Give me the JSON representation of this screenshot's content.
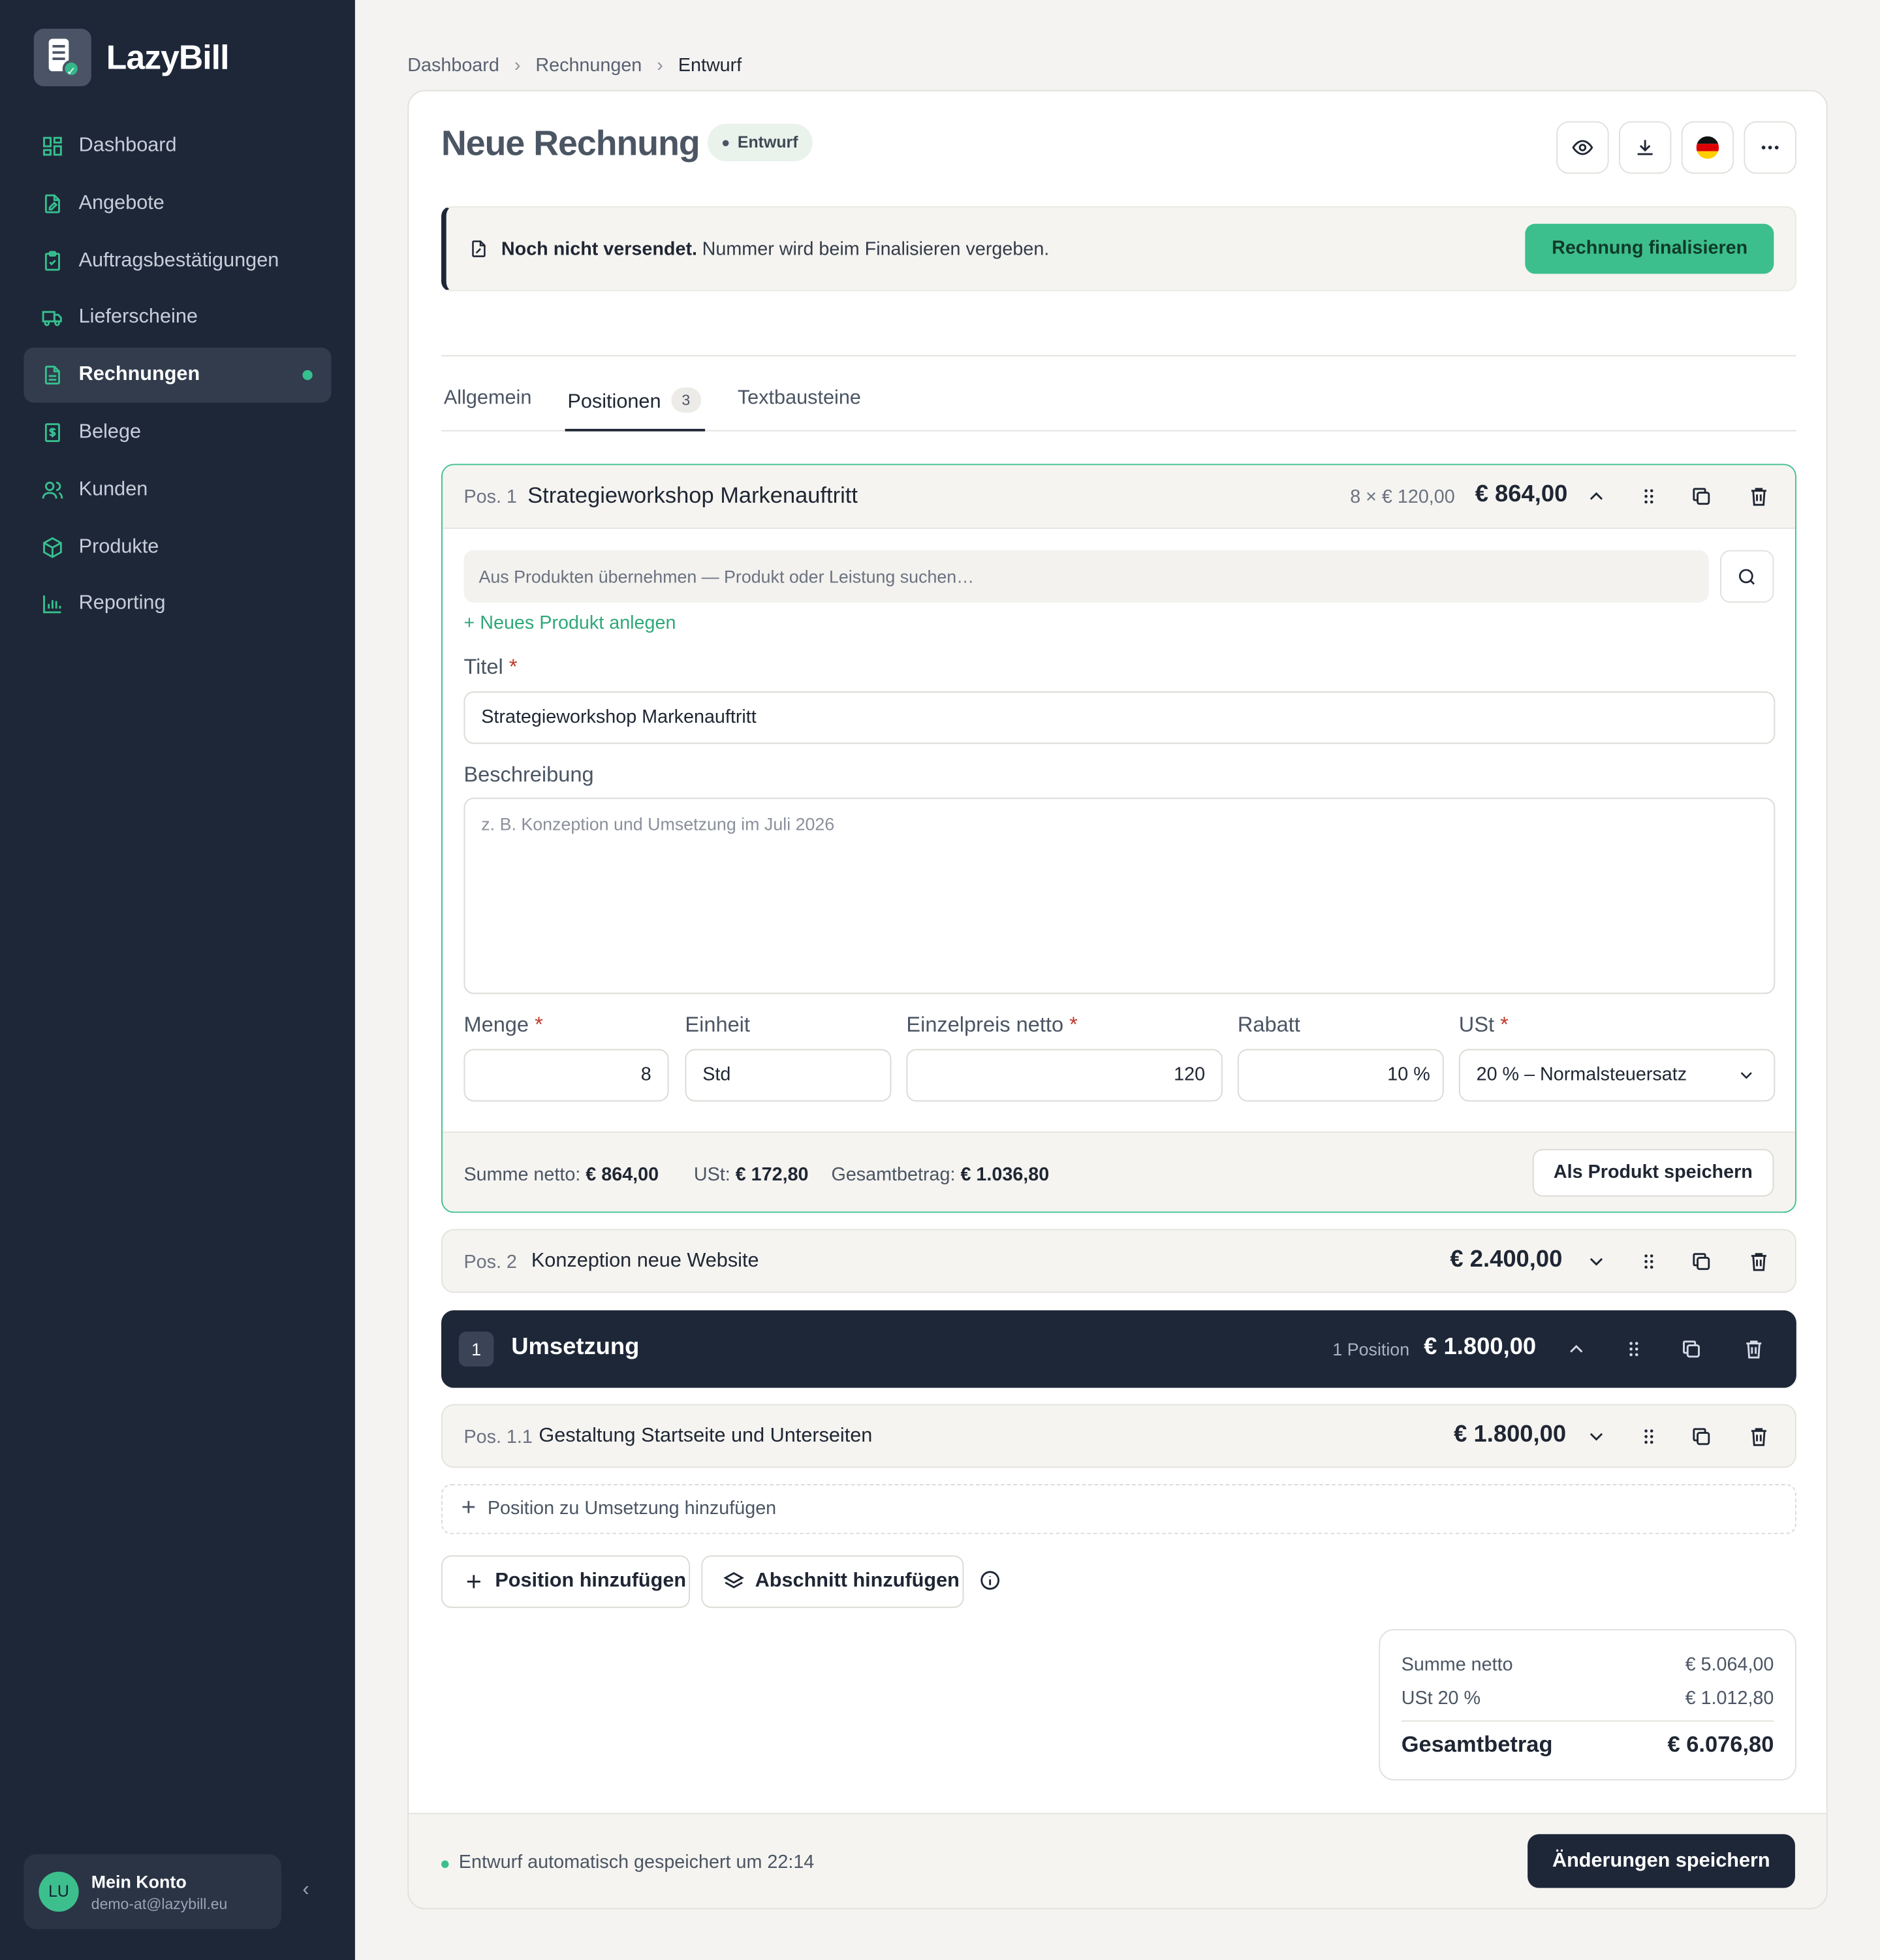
{
  "app": {
    "name": "LazyBill"
  },
  "sidebar": {
    "items": [
      {
        "label": "Dashboard",
        "icon": "grid-icon"
      },
      {
        "label": "Angebote",
        "icon": "doc-edit-icon"
      },
      {
        "label": "Auftragsbestätigungen",
        "icon": "clipboard-check-icon"
      },
      {
        "label": "Lieferscheine",
        "icon": "truck-icon"
      },
      {
        "label": "Rechnungen",
        "icon": "invoice-icon",
        "active": true
      },
      {
        "label": "Belege",
        "icon": "receipt-icon"
      },
      {
        "label": "Kunden",
        "icon": "users-icon"
      },
      {
        "label": "Produkte",
        "icon": "box-icon"
      },
      {
        "label": "Reporting",
        "icon": "bar-chart-icon"
      }
    ],
    "account": {
      "initials": "LU",
      "name": "Mein Konto",
      "email": "demo-at@lazybill.eu"
    }
  },
  "breadcrumb": [
    "Dashboard",
    "Rechnungen",
    "Entwurf"
  ],
  "page": {
    "title": "Neue Rechnung",
    "status": "Entwurf",
    "notice_bold": "Noch nicht versendet.",
    "notice_text": "Nummer wird beim Finalisieren vergeben.",
    "finalize_label": "Rechnung finalisieren"
  },
  "tabs": [
    {
      "label": "Allgemein"
    },
    {
      "label": "Positionen",
      "count": "3",
      "active": true
    },
    {
      "label": "Textbausteine"
    }
  ],
  "pos1": {
    "label": "Pos. 1",
    "title": "Strategieworkshop Markenauftritt",
    "qty_price": "8 × € 120,00",
    "amount": "€ 864,00",
    "search_placeholder": "Aus Produkten übernehmen — Produkt oder Leistung suchen…",
    "new_product": "Neues Produkt anlegen",
    "title_label": "Titel",
    "title_value": "Strategieworkshop Markenauftritt",
    "desc_label": "Beschreibung",
    "desc_placeholder": "z. B. Konzeption und Umsetzung im Juli 2026",
    "menge_label": "Menge",
    "menge_value": "8",
    "einheit_label": "Einheit",
    "einheit_value": "Std",
    "preis_label": "Einzelpreis netto",
    "preis_value": "120",
    "rabatt_label": "Rabatt",
    "rabatt_value": "10 %",
    "ust_label": "USt",
    "ust_value": "20 % – Normalsteuersatz",
    "sum_netto_label": "Summe netto:",
    "sum_netto": "€ 864,00",
    "sum_ust_label": "USt:",
    "sum_ust": "€ 172,80",
    "sum_total_label": "Gesamtbetrag:",
    "sum_total": "€ 1.036,80",
    "save_product": "Als Produkt speichern"
  },
  "pos2": {
    "label": "Pos. 2",
    "title": "Konzeption neue Website",
    "amount": "€ 2.400,00"
  },
  "section1": {
    "num": "1",
    "title": "Umsetzung",
    "count": "1 Position",
    "amount": "€ 1.800,00"
  },
  "pos11": {
    "label": "Pos. 1.1",
    "title": "Gestaltung Startseite und Unterseiten",
    "amount": "€ 1.800,00"
  },
  "add_inline": "Position zu Umsetzung hinzufügen",
  "add_position": "Position hinzufügen",
  "add_section": "Abschnitt hinzufügen",
  "totals": {
    "netto_label": "Summe netto",
    "netto": "€ 5.064,00",
    "ust_label": "USt 20 %",
    "ust": "€ 1.012,80",
    "total_label": "Gesamtbetrag",
    "total": "€ 6.076,80"
  },
  "footer": {
    "autosave": "Entwurf automatisch gespeichert um 22:14",
    "save_label": "Änderungen speichern"
  },
  "colors": {
    "accent": "#3dbf8d",
    "sidebar": "#1e2738",
    "danger": "#c0392b"
  }
}
